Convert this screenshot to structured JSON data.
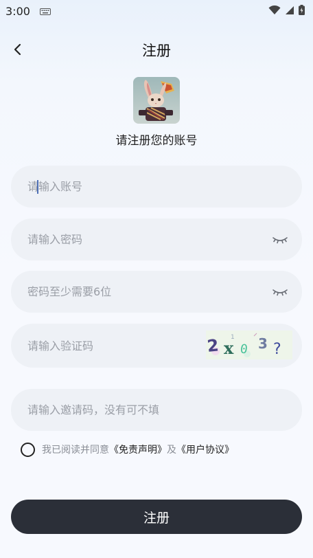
{
  "status_bar": {
    "time": "3:00",
    "icons": [
      "keyboard-icon",
      "wifi-icon",
      "signal-icon",
      "battery-icon"
    ]
  },
  "header": {
    "title": "注册",
    "back_icon": "chevron-left-icon"
  },
  "intro": {
    "subtitle": "请注册您的账号"
  },
  "form": {
    "account_placeholder": "请输入账号",
    "password_placeholder": "请输入密码",
    "confirm_placeholder": "密码至少需要6位",
    "captcha_placeholder": "请输入验证码",
    "captcha_text": "2x03?",
    "invite_placeholder": "请输入邀请码，没有可不填"
  },
  "agreement": {
    "prefix": "我已阅读并同意",
    "disclaimer_link": "《免责声明》",
    "and": "及",
    "user_agreement_link": "《用户协议》"
  },
  "submit": {
    "label": "注册"
  },
  "colors": {
    "button_bg": "#2b2f38",
    "field_bg": "#eef1f6",
    "placeholder": "#9a9ea6",
    "page_bg": "#f7f9fe"
  }
}
